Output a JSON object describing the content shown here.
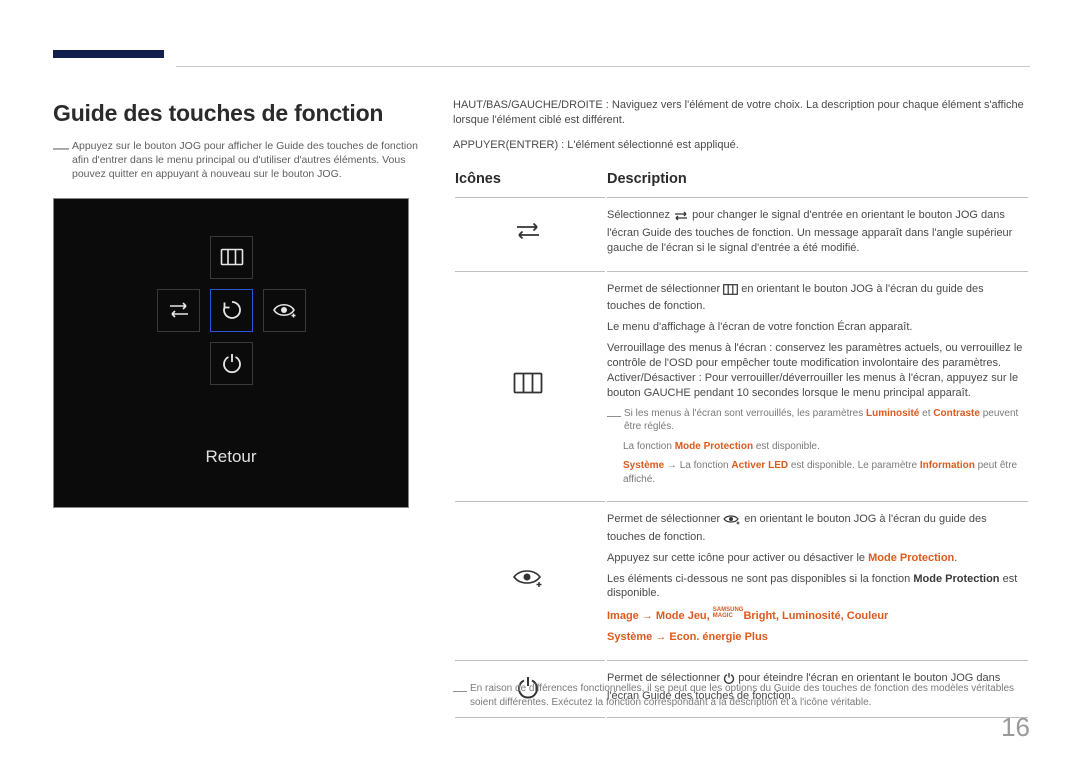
{
  "title": "Guide des touches de fonction",
  "leftNote": "Appuyez sur le bouton JOG pour afficher le Guide des touches de fonction afin d'entrer dans le menu principal ou d'utiliser d'autres éléments. Vous pouvez quitter en appuyant à nouveau sur le bouton JOG.",
  "panel": {
    "retour": "Retour"
  },
  "intro": {
    "p1": "HAUT/BAS/GAUCHE/DROITE : Naviguez vers l'élément de votre choix. La description pour chaque élément s'affiche lorsque l'élément ciblé est différent.",
    "p2": "APPUYER(ENTRER) : L'élément sélectionné est appliqué."
  },
  "headers": {
    "icons": "Icônes",
    "desc": "Description"
  },
  "rows": {
    "r1": {
      "a": "Sélectionnez ",
      "b": " pour changer le signal d'entrée en orientant le bouton JOG dans l'écran Guide des touches de fonction. Un message apparaît dans l'angle supérieur gauche de l'écran si le signal d'entrée a été modifié."
    },
    "r2": {
      "a": "Permet de sélectionner ",
      "b": " en orientant le bouton JOG à l'écran du guide des touches de fonction.",
      "c": "Le menu d'affichage à l'écran de votre fonction Écran apparaît.",
      "d": "Verrouillage des menus à l'écran : conservez les paramètres actuels, ou verrouillez le contrôle de l'OSD pour empêcher toute modification involontaire des paramètres. Activer/Désactiver : Pour verrouiller/déverrouiller les menus à l'écran, appuyez sur le bouton GAUCHE pendant 10 secondes lorsque le menu principal apparaît.",
      "n1a": "Si les menus à l'écran sont verrouillés, les paramètres ",
      "n1_lum": "Luminosité",
      "n1_et": " et ",
      "n1_con": "Contraste",
      "n1b": " peuvent être réglés.",
      "n2a": "La fonction ",
      "n2_mp": "Mode Protection",
      "n2b": " est disponible.",
      "n3_sys": "Système",
      "n3a": " → La fonction ",
      "n3_led": "Activer LED",
      "n3b": " est disponible. Le paramètre ",
      "n3_info": "Information",
      "n3c": " peut être affiché."
    },
    "r3": {
      "a": "Permet de sélectionner ",
      "b": " en orientant le bouton JOG à l'écran du guide des touches de fonction.",
      "c1": "Appuyez sur cette icône pour activer ou désactiver le ",
      "c2": "Mode Protection",
      "c3": ".",
      "d1": "Les éléments ci-dessous ne sont pas disponibles si la fonction ",
      "d2": "Mode Protection",
      "d3": " est disponible.",
      "e_img": "Image",
      "e_arr1": " → ",
      "e_mj": "Mode Jeu",
      "e_sep1": ", ",
      "e_bright": "Bright",
      "e_sep2": ", ",
      "e_lum": "Luminosité",
      "e_sep3": ", ",
      "e_col": "Couleur",
      "f_sys": "Système",
      "f_arr": " → ",
      "f_econ": "Econ. énergie Plus"
    },
    "r4": {
      "a": "Permet de sélectionner ",
      "b": " pour éteindre l'écran en orientant le bouton JOG dans l'écran Guide des touches de fonction."
    }
  },
  "footnote": "En raison de différences fonctionnelles, il se peut que les options du Guide des touches de fonction des modèles véritables soient différentes. Exécutez la fonction correspondant à la description et à l'icône véritable.",
  "page": "16",
  "magic": {
    "s": "SAMSUNG",
    "m": "MAGIC"
  }
}
